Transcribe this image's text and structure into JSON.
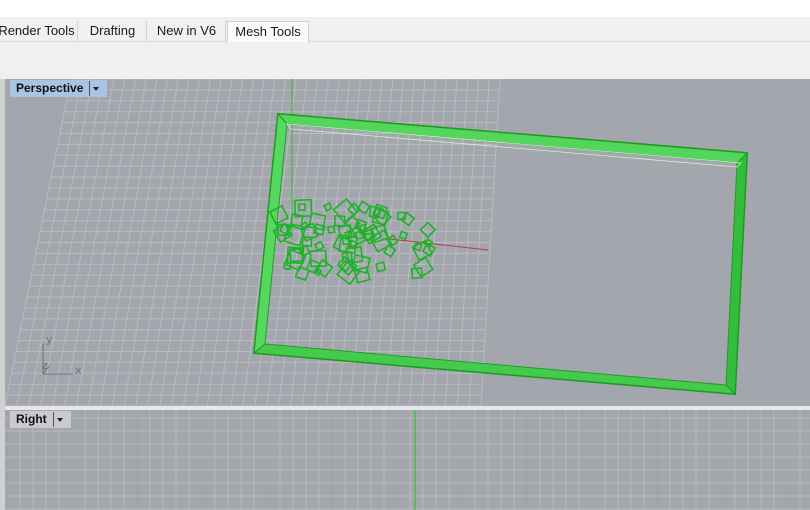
{
  "ribbon": {
    "tabs": [
      {
        "label": "Render Tools"
      },
      {
        "label": "Drafting"
      },
      {
        "label": "New in V6"
      },
      {
        "label": "Mesh Tools"
      }
    ]
  },
  "viewports": {
    "perspective": {
      "label": "Perspective",
      "axis": {
        "x": "x",
        "y": "y",
        "z": "z"
      }
    },
    "right": {
      "label": "Right"
    }
  },
  "colors": {
    "viewport_bg": "#a3a7ad",
    "active_label_bg": "#a9c3e2",
    "selection_green": "#22c52a",
    "x_axis": "#b04040",
    "y_axis": "#28c028"
  },
  "icons": {
    "viewport_menu": "dropdown-arrow-icon"
  }
}
